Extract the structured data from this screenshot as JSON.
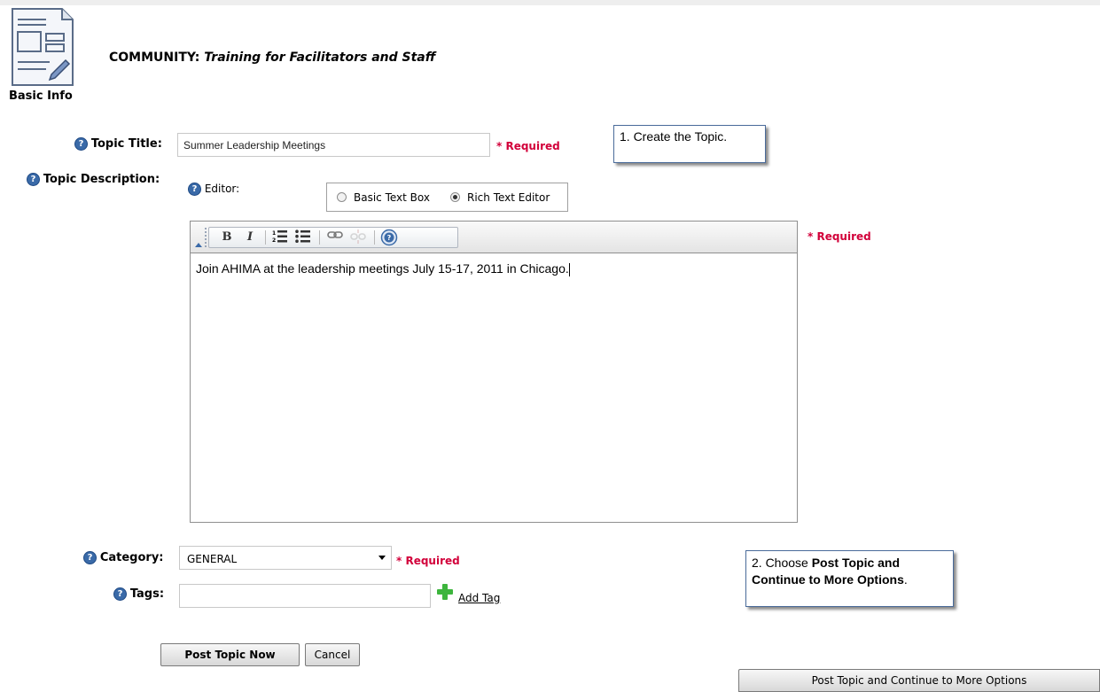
{
  "header": {
    "icon_label": "Basic Info",
    "community_prefix": "COMMUNITY:",
    "community_name": "Training for Facilitators and Staff"
  },
  "form": {
    "topic_title": {
      "label": "Topic Title:",
      "value": "Summer Leadership Meetings",
      "required": "* Required"
    },
    "topic_description": {
      "label": "Topic Description:",
      "editor_label": "Editor:",
      "option_basic": "Basic Text Box",
      "option_rich": "Rich Text Editor",
      "selected_option": "Rich Text Editor",
      "required": "* Required",
      "body_text": "Join AHIMA at the leadership meetings July 15-17, 2011 in Chicago."
    },
    "category": {
      "label": "Category:",
      "selected": "GENERAL",
      "required": "* Required"
    },
    "tags": {
      "label": "Tags:",
      "value": "",
      "add_tag": "Add Tag"
    }
  },
  "toolbar": {
    "buttons": [
      "bold-icon",
      "italic-icon",
      "ordered-list-icon",
      "unordered-list-icon",
      "link-icon",
      "unlink-icon",
      "help-icon"
    ]
  },
  "buttons": {
    "post_now": "Post Topic Now",
    "cancel": "Cancel",
    "post_continue": "Post Topic and Continue to More Options"
  },
  "callouts": {
    "step1": "1. Create the Topic.",
    "step2_prefix": "2. Choose ",
    "step2_bold": "Post Topic and Continue to More Options",
    "step2_suffix": "."
  },
  "colors": {
    "required": "#d2003a",
    "help_icon": "#3a6aa8",
    "add_icon": "#3db53d"
  }
}
